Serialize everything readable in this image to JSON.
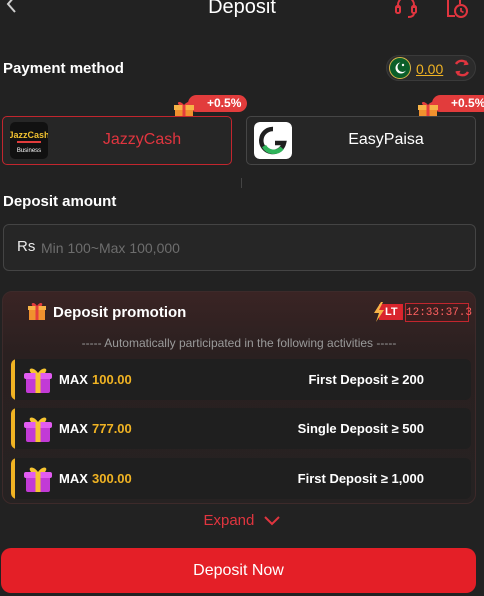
{
  "header": {
    "title": "Deposit",
    "back_icon": "chevron-left-icon",
    "support_icon": "headset-icon",
    "history_icon": "history-clock-icon"
  },
  "payment": {
    "title": "Payment method",
    "balance": "0.00",
    "flag_icon": "pakistan-flag-icon",
    "refresh_icon": "refresh-icon",
    "methods": [
      {
        "label": "JazzyCash",
        "bonus": "+0.5%",
        "logo_text": "JazzCash",
        "logo_sub": "Business",
        "selected": true
      },
      {
        "label": "EasyPaisa",
        "bonus": "+0.5%",
        "selected": false
      }
    ]
  },
  "amount": {
    "title": "Deposit amount",
    "currency": "Rs",
    "placeholder": "Min 100~Max 100,000"
  },
  "promotion": {
    "title": "Deposit promotion",
    "lt_label": "LT",
    "countdown": "12:33:37.3",
    "subtitle": "----- Automatically participated in the following activities -----",
    "rows": [
      {
        "max_label": "MAX",
        "max_value": "100.00",
        "condition": "First Deposit ≥ 200"
      },
      {
        "max_label": "MAX",
        "max_value": "777.00",
        "condition": "Single Deposit ≥ 500"
      },
      {
        "max_label": "MAX",
        "max_value": "300.00",
        "condition": "First Deposit ≥ 1,000"
      }
    ]
  },
  "expand_label": "Expand",
  "deposit_button": "Deposit Now",
  "colors": {
    "background": "#222222",
    "accent_red": "#e41f27",
    "gold": "#f0b323"
  }
}
